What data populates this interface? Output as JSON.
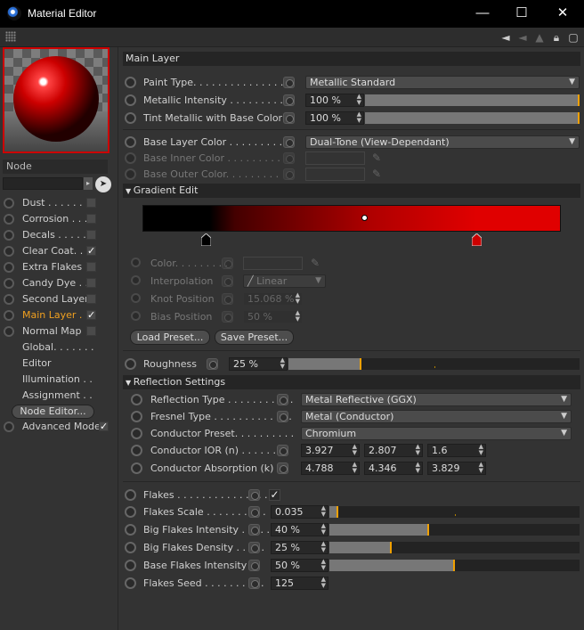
{
  "window": {
    "title": "Material Editor",
    "minimize": "—",
    "maximize": "☐",
    "close": "✕"
  },
  "toolbar": {
    "icons": [
      "navigate-back-icon",
      "navigate-forward-icon",
      "arrow-up-icon",
      "lock-icon",
      "new-window-icon"
    ]
  },
  "sidebar": {
    "node_header": "Node",
    "node_editor_button": "Node Editor...",
    "channels": [
      {
        "label": "Dust . . . . . . .",
        "checked": false,
        "bullet": true
      },
      {
        "label": "Corrosion . . . .",
        "checked": false,
        "bullet": true
      },
      {
        "label": "Decals . . . . . .",
        "checked": false,
        "bullet": true
      },
      {
        "label": "Clear Coat. .",
        "checked": true,
        "bullet": true
      },
      {
        "label": "Extra Flakes",
        "checked": false,
        "bullet": true
      },
      {
        "label": "Candy Dye . . .",
        "checked": false,
        "bullet": true
      },
      {
        "label": "Second Layer",
        "checked": false,
        "bullet": true
      },
      {
        "label": "Main Layer . .",
        "checked": true,
        "bullet": true,
        "active": true
      },
      {
        "label": "Normal Map",
        "checked": false,
        "bullet": true
      },
      {
        "label": "Global. . . . . . .",
        "bullet": false
      },
      {
        "label": "Editor",
        "bullet": false
      },
      {
        "label": "Illumination . .",
        "bullet": false
      },
      {
        "label": "Assignment . .",
        "bullet": false
      }
    ],
    "advanced_mode": {
      "label": "Advanced Mode",
      "checked": true
    }
  },
  "main": {
    "section_title": "Main Layer",
    "paint_type": {
      "label": "Paint Type. . . . . . . . . . . . . . .",
      "value": "Metallic Standard"
    },
    "metallic_intensity": {
      "label": "Metallic Intensity . . . . . . . . .",
      "value": "100 %",
      "fraction": 1.0
    },
    "tint_metallic": {
      "label": "Tint Metallic with Base Color",
      "value": "100 %",
      "fraction": 1.0
    },
    "base_layer_color": {
      "label": "Base Layer Color . . . . . . . . . . .",
      "value": "Dual-Tone (View-Dependant)"
    },
    "base_inner_color": {
      "label": "Base Inner Color . . . . . . . . ."
    },
    "base_outer_color": {
      "label": "Base Outer Color. . . . . . . . ."
    },
    "gradient_edit": {
      "title": "Gradient Edit",
      "color": {
        "label": "Color. . . . . . . . ."
      },
      "interpolation": {
        "label": "Interpolation",
        "value": "Linear"
      },
      "knot_position": {
        "label": "Knot Position",
        "value": "15.068 %"
      },
      "bias_position": {
        "label": "Bias Position",
        "value": "50 %"
      },
      "load_preset": "Load Preset...",
      "save_preset": "Save Preset..."
    },
    "roughness": {
      "label": "Roughness",
      "value": "25 %",
      "fraction": 0.25
    },
    "reflection": {
      "title": "Reflection Settings",
      "reflection_type": {
        "label": "Reflection Type . . . . . . . . . . .",
        "value": "Metal Reflective (GGX)"
      },
      "fresnel_type": {
        "label": "Fresnel Type . . . . . . . . . . . . .",
        "value": "Metal (Conductor)"
      },
      "conductor_preset": {
        "label": "Conductor Preset. . . . . . . . . .",
        "value": "Chromium"
      },
      "conductor_ior": {
        "label": "Conductor IOR (n) . . . . . . .",
        "values": [
          "3.927",
          "2.807",
          "1.6"
        ]
      },
      "conductor_absorption": {
        "label": "Conductor Absorption (k)",
        "values": [
          "4.788",
          "4.346",
          "3.829"
        ]
      }
    },
    "flakes": {
      "flakes": {
        "label": "Flakes . . . . . . . . . . . . . . .",
        "checked": true
      },
      "flakes_scale": {
        "label": "Flakes Scale . . . . . . . . . .",
        "value": "0.035",
        "fraction": 0.035
      },
      "big_flakes_intensity": {
        "label": "Big Flakes Intensity . . . . .",
        "value": "40 %",
        "fraction": 0.4
      },
      "big_flakes_density": {
        "label": "Big Flakes Density . . . . .",
        "value": "25 %",
        "fraction": 0.25
      },
      "base_flakes_intensity": {
        "label": "Base Flakes Intensity",
        "value": "50 %",
        "fraction": 0.5
      },
      "flakes_seed": {
        "label": "Flakes Seed . . . . . . . . . .",
        "value": "125"
      }
    }
  },
  "colors": {
    "accent": "#f0a020",
    "preview_border": "#cc0000",
    "gradient_red": "#e00000",
    "knob_red": "#cc0000"
  }
}
